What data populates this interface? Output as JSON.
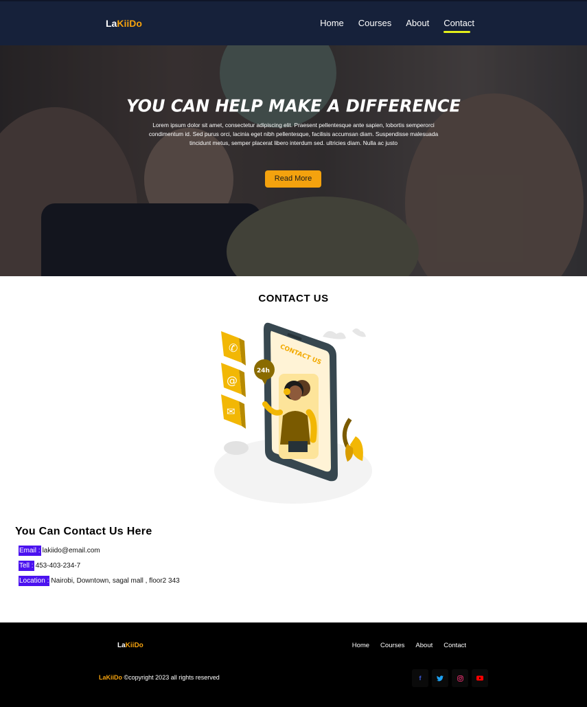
{
  "nav": {
    "logo_part1": "La",
    "logo_part2": "KiiDo",
    "links": [
      "Home",
      "Courses",
      "About",
      "Contact"
    ],
    "active": "Contact"
  },
  "hero": {
    "title": "YOU CAN HELP MAKE A DIFFERENCE",
    "text": "Lorem ipsum dolor sit amet, consectetur adipiscing elit. Praesent pellentesque ante sapien, lobortis semperorci condimentum id. Sed purus orci, lacinia eget nibh pellentesque, facilisis accumsan diam. Suspendisse malesuada tincidunt metus, semper placerat libero interdum sed. ultricies diam. Nulla ac justo",
    "button": "Read More"
  },
  "contact": {
    "title": "CONTACT US",
    "illustration_text": "CONTACT US",
    "badge_24h": "24h",
    "heading": "You Can Contact Us Here",
    "email_label": "Email :",
    "email_value": "lakiido@email.com",
    "tel_label": "Tell :",
    "tel_value": "453-403-234-7",
    "location_label": "Location :",
    "location_value": "Nairobi, Downtown, sagal mall , floor2 343"
  },
  "footer": {
    "logo_part1": "La",
    "logo_part2": "KiiDo",
    "links": [
      "Home",
      "Courses",
      "About",
      "Contact"
    ],
    "copy_brand": "LaKiiDo",
    "copy_text": "©copyright 2023 all rights reserved",
    "socials": [
      {
        "icon": "facebook-icon",
        "glyph": "f",
        "color": "#3b5bdb"
      },
      {
        "icon": "twitter-icon",
        "glyph": "🐦",
        "color": "#1da1f2"
      },
      {
        "icon": "instagram-icon",
        "glyph": "◎",
        "color": "#e1306c"
      },
      {
        "icon": "youtube-icon",
        "glyph": "▶",
        "color": "#ff0000"
      }
    ]
  },
  "colors": {
    "nav_bg": "#16213a",
    "accent": "#f4a20e",
    "label_bg": "#4b12ef",
    "footer_bg": "#000000"
  }
}
